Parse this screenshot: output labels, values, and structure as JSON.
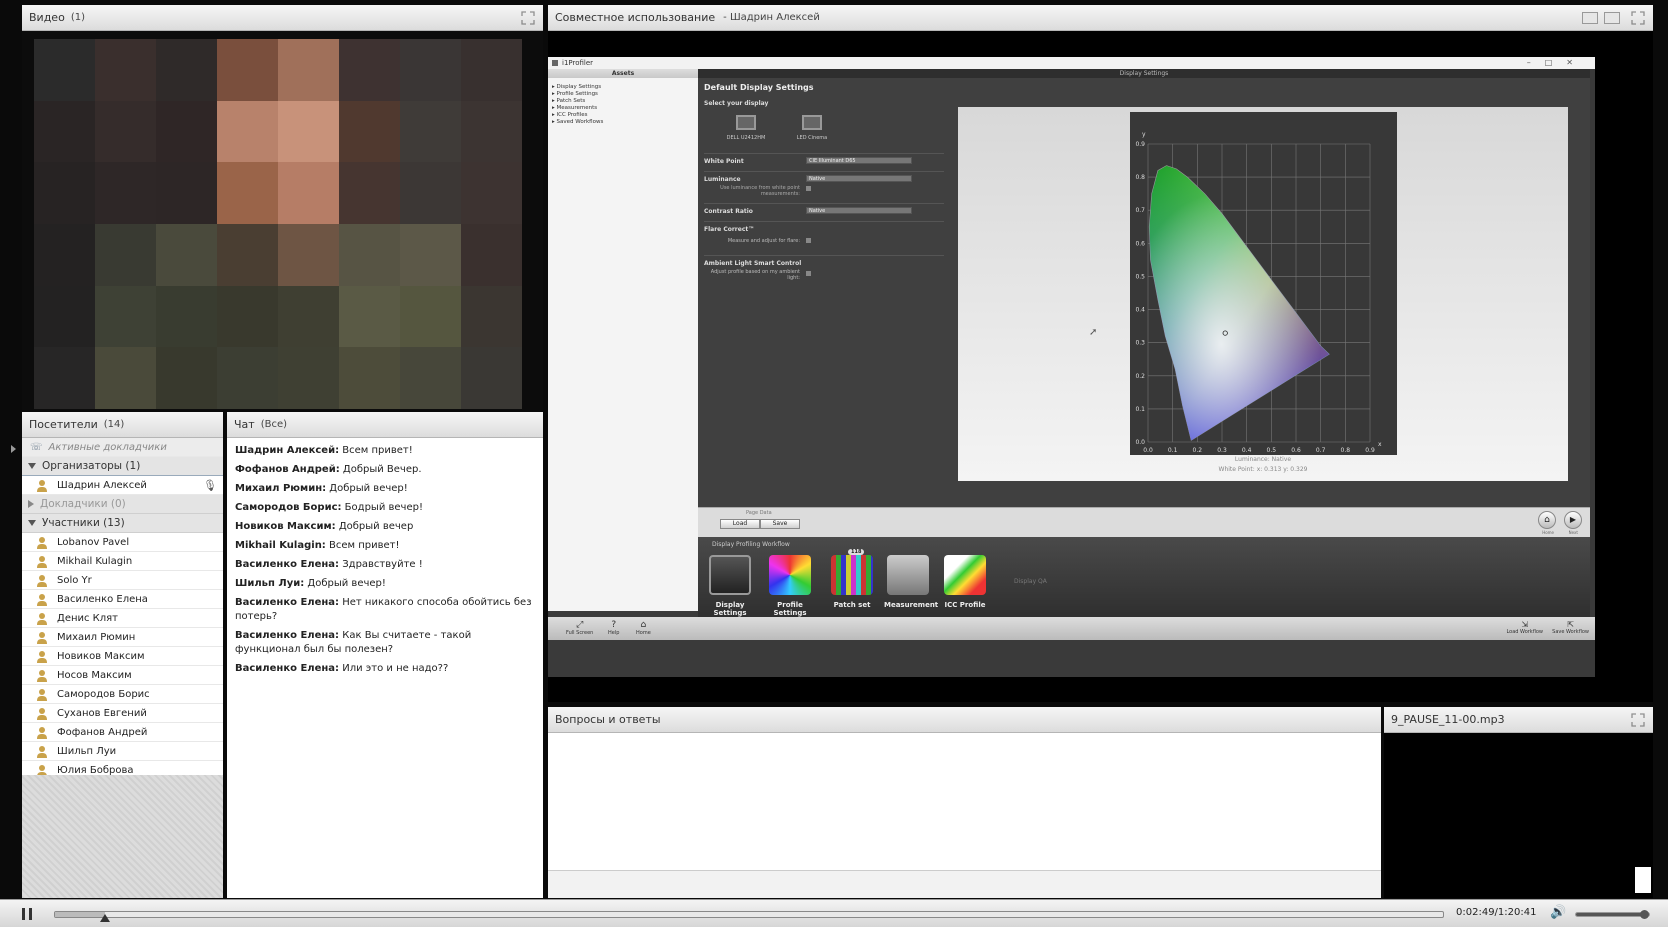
{
  "video": {
    "title": "Видео",
    "count": "(1)",
    "mosaic": [
      "#2b2b2b",
      "#3a2f2d",
      "#2f2a29",
      "#7a4f3d",
      "#a0705a",
      "#3e3231",
      "#3a3635",
      "#38302f",
      "#2a2525",
      "#352c2b",
      "#2f2626",
      "#b8826b",
      "#c8927a",
      "#50392f",
      "#3f3b38",
      "#3c3432",
      "#272323",
      "#2e2727",
      "#2d2626",
      "#9a6449",
      "#b67d66",
      "#463530",
      "#3c3735",
      "#3d3331",
      "#242222",
      "#393a32",
      "#4a4a3c",
      "#4a3e32",
      "#6e5544",
      "#575444",
      "#5c5848",
      "#3a302e",
      "#232222",
      "#3e4135",
      "#393c30",
      "#39392d",
      "#3f3f32",
      "#5a5a45",
      "#55563f",
      "#3b3631",
      "#272626",
      "#4a4a3a",
      "#38392d",
      "#3c3e33",
      "#3f4033",
      "#4d4c3a",
      "#47473a",
      "#3a3834"
    ]
  },
  "share": {
    "title": "Совместное использование",
    "presenter": "- Шадрин Алексей",
    "app": {
      "window_title": "i1Profiler",
      "assets_header": "Assets",
      "tree": [
        "Display Settings",
        "Profile Settings",
        "Patch Sets",
        "Measurements",
        "ICC Profiles",
        "Saved Workflows"
      ],
      "topbar": "Display Settings",
      "form_title": "Default Display Settings",
      "select_display": "Select your display",
      "displays": [
        "DELL U2412HM",
        "LED Cinema"
      ],
      "white_point_label": "White Point",
      "white_point_value": "CIE Illuminant D65",
      "luminance_label": "Luminance",
      "luminance_value": "Native",
      "luminance_note": "Use luminance from white point measurements:",
      "contrast_label": "Contrast Ratio",
      "contrast_value": "Native",
      "flare_label": "Flare Correct™",
      "flare_note": "Measure and adjust for flare:",
      "ambient_label": "Ambient Light Smart Control",
      "ambient_note": "Adjust profile based on my ambient light:",
      "chart_caption_1": "Luminance: Native",
      "chart_caption_2": "White Point: x: 0.313 y: 0.329",
      "page_data_label": "Page Data",
      "load_btn": "Load",
      "save_btn": "Save",
      "home_label": "Home",
      "next_label": "Next",
      "workflow_title": "Display Profiling Workflow",
      "workflow_steps": [
        "Display Settings",
        "Profile Settings",
        "Patch set",
        "Measurement",
        "ICC Profile"
      ],
      "patch_badge": "118",
      "display_qa": "Display QA",
      "tb_fullscreen": "Full Screen",
      "tb_help": "Help",
      "tb_home": "Home",
      "tb_load": "Load Workflow",
      "tb_save": "Save Workflow"
    }
  },
  "chart_data": {
    "type": "scatter",
    "title": "",
    "xlabel": "x",
    "ylabel": "y",
    "xlim": [
      0.0,
      0.9
    ],
    "ylim": [
      0.0,
      0.9
    ],
    "x_ticks": [
      "0.0",
      "0.1",
      "0.2",
      "0.3",
      "0.4",
      "0.5",
      "0.6",
      "0.7",
      "0.8",
      "0.9"
    ],
    "y_ticks": [
      "0.0",
      "0.1",
      "0.2",
      "0.3",
      "0.4",
      "0.5",
      "0.6",
      "0.7",
      "0.8",
      "0.9"
    ],
    "series": [
      {
        "values": [
          {
            "x": 0.313,
            "y": 0.329
          }
        ]
      }
    ],
    "grid": true
  },
  "attendees": {
    "title": "Посетители",
    "count": "(14)",
    "active": "Активные докладчики",
    "hosts": "Организаторы (1)",
    "host_name": "Шадрин Алексей",
    "presenters": "Докладчики (0)",
    "participants": "Участники (13)",
    "names": [
      "Lobanov Pavel",
      "Mikhail Kulagin",
      "Solo Yr",
      "Василенко Елена",
      "Денис Клят",
      "Михаил Рюмин",
      "Новиков Максим",
      "Носов Максим",
      "Самородов Борис",
      "Суханов Евгений",
      "Фофанов Андрей",
      "Шильп Луи",
      "Юлия Боброва"
    ]
  },
  "chat": {
    "title": "Чат",
    "scope": "(Все)",
    "messages": [
      {
        "who": "Шадрин Алексей:",
        "text": " Всем привет!"
      },
      {
        "who": "Фофанов Андрей:",
        "text": " Добрый Вечер."
      },
      {
        "who": "Михаил Рюмин:",
        "text": " Добрый вечер!"
      },
      {
        "who": "Самородов Борис:",
        "text": " Бодрый вечер!"
      },
      {
        "who": "Новиков Максим:",
        "text": " Добрый вечер"
      },
      {
        "who": "Mikhail Kulagin:",
        "text": " Всем привет!"
      },
      {
        "who": "Василенко Елена:",
        "text": " Здравствуйте !"
      },
      {
        "who": "Шильп Луи:",
        "text": " Добрый вечер!"
      },
      {
        "who": "Василенко Елена:",
        "text": " Нет никакого способа обойтись без потерь?"
      },
      {
        "who": "Василенко Елена:",
        "text": " Как Вы считаете - такой функционал был бы полезен?"
      },
      {
        "who": "Василенко Елена:",
        "text": " Или это и не надо??"
      }
    ]
  },
  "qa": {
    "title": "Вопросы и ответы"
  },
  "mp3": {
    "title": "9_PAUSE_11-00.mp3"
  },
  "player": {
    "time": "0:02:49/1:20:41",
    "progress": 0.036,
    "volume": 0.95
  }
}
